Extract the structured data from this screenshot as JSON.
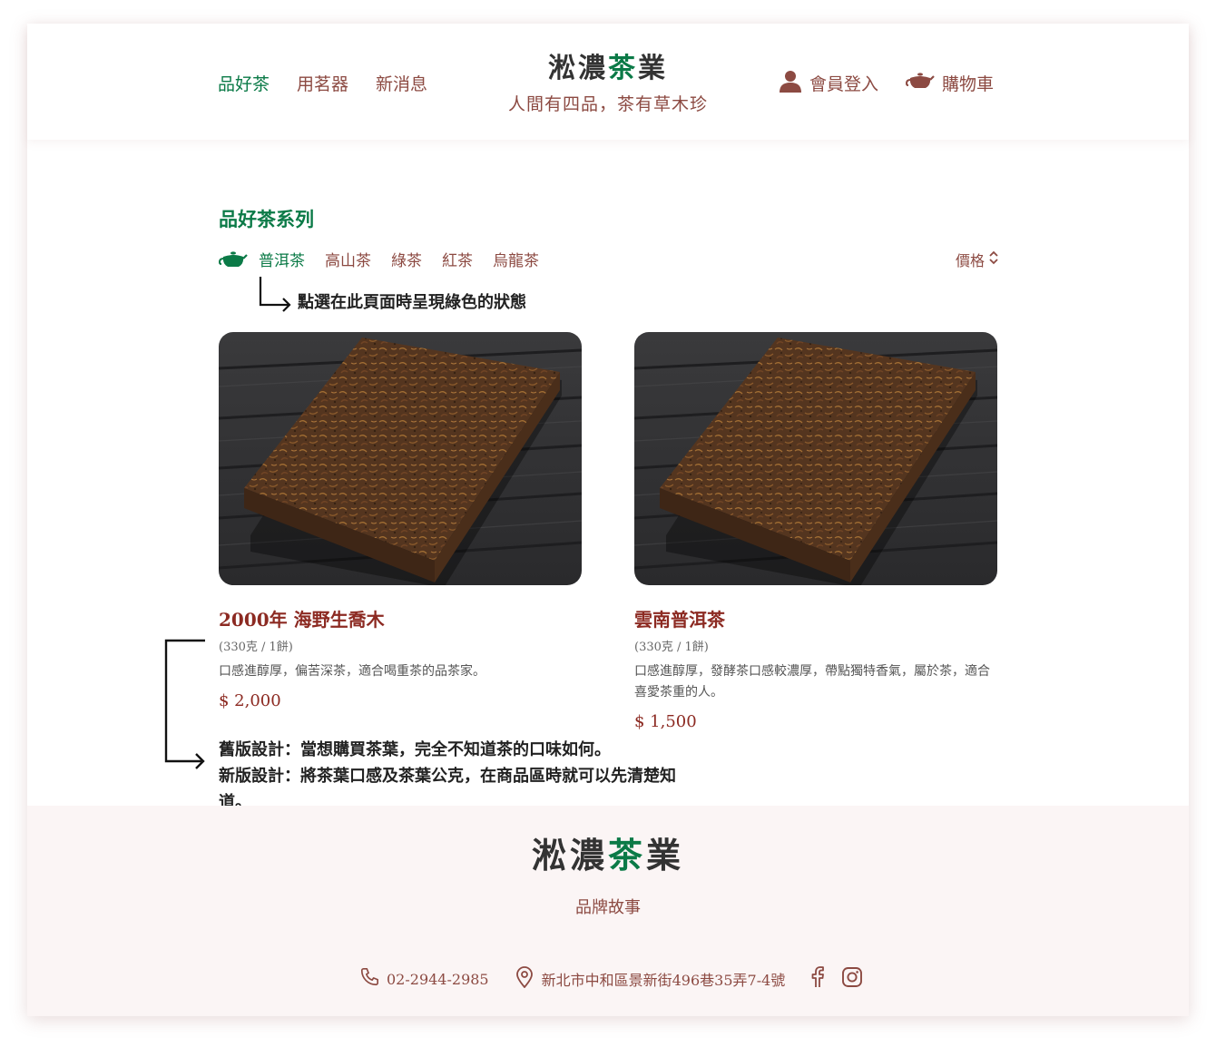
{
  "header": {
    "nav_left": [
      "品好茶",
      "用茗器",
      "新消息"
    ],
    "brand_part1": "淞濃",
    "brand_part2": "茶",
    "brand_part3": "業",
    "slogan": "人間有四品，茶有草木珍",
    "login_label": "會員登入",
    "cart_label": "購物車"
  },
  "section": {
    "title": "品好茶系列",
    "tabs": [
      "普洱茶",
      "高山茶",
      "綠茶",
      "紅茶",
      "烏龍茶"
    ],
    "active_tab": "普洱茶",
    "sort_label": "價格"
  },
  "annotations": {
    "tab_note": "點選在此頁面時呈現綠色的狀態",
    "design_note_line1": "舊版設計：當想購買茶葉，完全不知道茶的口味如何。",
    "design_note_line2": "新版設計：將茶葉口感及茶葉公克，在商品區時就可以先清楚知道。"
  },
  "products": [
    {
      "name": "2000年 海野生喬木",
      "spec": "(330克 / 1餅)",
      "desc": "口感進醇厚，偏苦深茶，適合喝重茶的品茶家。",
      "price": "$ 2,000"
    },
    {
      "name": "雲南普洱茶",
      "spec": "(330克 / 1餅)",
      "desc": "口感進醇厚，發酵茶口感較濃厚，帶點獨特香氣，屬於茶，適合喜愛茶重的人。",
      "price": "$ 1,500"
    }
  ],
  "footer": {
    "brand_part1": "淞濃",
    "brand_part2": "茶",
    "brand_part3": "業",
    "story": "品牌故事",
    "phone": "02-2944-2985",
    "address": "新北市中和區景新街496巷35弄7-4號"
  },
  "colors": {
    "green": "#0b7a47",
    "brown": "#8c4a42",
    "price": "#8c2a22",
    "footer_bg": "#fbf5f5"
  },
  "icons": [
    "user-icon",
    "teapot-icon",
    "chevron-updown-icon",
    "phone-icon",
    "map-pin-icon",
    "facebook-icon",
    "instagram-icon"
  ]
}
